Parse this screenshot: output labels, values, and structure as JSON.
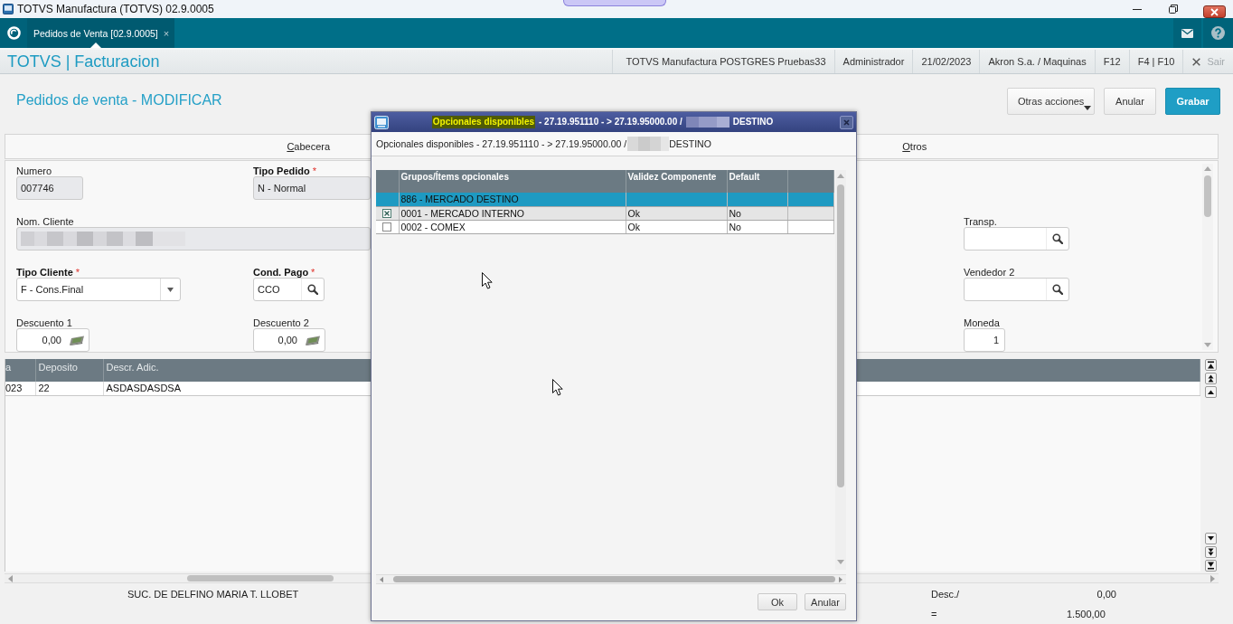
{
  "window": {
    "title": "TOTVS Manufactura (TOTVS) 02.9.0005"
  },
  "app_bar": {
    "tabs": [
      {
        "label": "Pedidos de Venta [02.9.0005]",
        "close_glyph": "×",
        "selected": true
      }
    ]
  },
  "module_bar": {
    "title": "TOTVS | Facturacion",
    "info": [
      "TOTVS Manufactura POSTGRES Pruebas33",
      "Administrador",
      "21/02/2023",
      "Akron S.a. / Maquinas",
      "F12",
      "F4 | F10"
    ],
    "exit": {
      "label": "Sair",
      "disabled": true
    }
  },
  "page": {
    "title": "Pedidos de venta - MODIFICAR",
    "actions": [
      {
        "label": "Otras acciones",
        "kind": "menu"
      },
      {
        "label": "Anular",
        "kind": "plain"
      },
      {
        "label": "Grabar",
        "kind": "primary"
      }
    ]
  },
  "folders": [
    {
      "label": "Cabecera"
    },
    {
      "label": "Otros"
    }
  ],
  "form": {
    "required_mark": "*",
    "main_fields": [
      {
        "label": "Numero",
        "required": false,
        "kind": "text",
        "value": "007746",
        "readonly": true
      },
      {
        "label": "Tipo Pedido",
        "required": true,
        "kind": "text",
        "value": "N - Normal",
        "readonly": true
      },
      {
        "label": "Nom. Cliente",
        "required": false,
        "kind": "blurred",
        "readonly": true
      },
      {
        "label": "Tipo Cliente",
        "required": true,
        "kind": "select",
        "value": "F - Cons.Final",
        "readonly": false
      },
      {
        "label": "Cond. Pago",
        "required": true,
        "kind": "lookup",
        "value": "CCO",
        "readonly": false
      },
      {
        "label": "Descuento 1",
        "required": false,
        "kind": "amount",
        "value": "0,00",
        "readonly": false
      },
      {
        "label": "Descuento 2",
        "required": false,
        "kind": "amount",
        "value": "0,00",
        "readonly": false
      }
    ],
    "side_fields": [
      {
        "label": "Transp.",
        "required": false,
        "kind": "lookup",
        "readonly": false
      },
      {
        "label": "Vendedor 2",
        "required": false,
        "kind": "lookup",
        "readonly": false
      },
      {
        "label": "Moneda",
        "required": false,
        "kind": "number",
        "value": "1",
        "readonly": false
      }
    ]
  },
  "items_grid": {
    "columns": [
      "a",
      "Deposito",
      "Descr. Adic."
    ],
    "rows": [
      [
        "023",
        "22",
        "ASDASDASDSA"
      ]
    ]
  },
  "footer": {
    "branch": "SUC. DE DELFINO MARIA T. LLOBET",
    "totals": [
      {
        "label": "Desc./",
        "value": "0,00"
      },
      {
        "label": "=",
        "value": "1.500,00"
      }
    ]
  },
  "dialog": {
    "title": [
      {
        "kind": "text",
        "text": "Opcionales disponibles",
        "highlighted": true
      },
      {
        "kind": "text",
        "text": "- 27.19.951110 - > 27.19.95000.00 /",
        "highlighted": false
      },
      {
        "kind": "redacted"
      },
      {
        "kind": "text",
        "text": "DESTINO",
        "highlighted": false
      }
    ],
    "subtitle": [
      {
        "kind": "text",
        "text": "Opcionales disponibles - 27.19.951110 - > 27.19.95000.00 /",
        "highlighted": false
      },
      {
        "kind": "redacted"
      },
      {
        "kind": "text",
        "text": "DESTINO",
        "highlighted": false
      }
    ],
    "table": {
      "columns": [
        "Grupos/Ítems opcionales",
        "Validez Componente",
        "Default"
      ],
      "rows": [
        {
          "kind": "group",
          "name": "886 - MERCADO DESTINO",
          "selected": true
        },
        {
          "kind": "item",
          "name": "0001 - MERCADO INTERNO",
          "validity": "Ok",
          "default": "No",
          "checked": true,
          "selected": false
        },
        {
          "kind": "item",
          "name": "0002 - COMEX",
          "validity": "Ok",
          "default": "No",
          "checked": false,
          "selected": false
        }
      ]
    },
    "buttons": [
      {
        "label": "Ok"
      },
      {
        "label": "Anular"
      }
    ]
  }
}
